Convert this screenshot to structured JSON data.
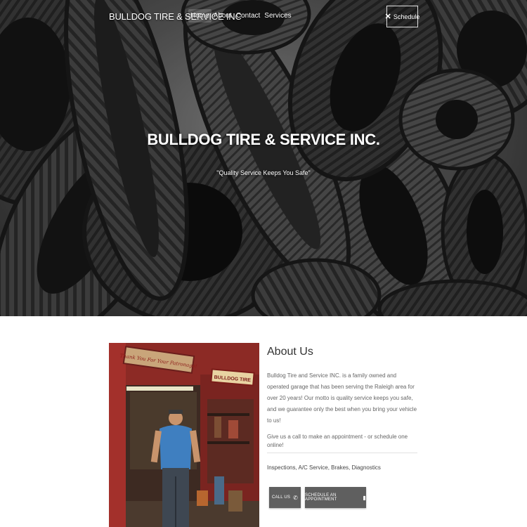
{
  "nav": {
    "brand": "BULLDOG TIRE & SERVICE INC",
    "links": [
      {
        "label": "Home",
        "active": true
      },
      {
        "label": "About",
        "active": false
      },
      {
        "label": "Contact",
        "active": false
      },
      {
        "label": "Services",
        "active": false
      }
    ],
    "schedule_label": "Schedule",
    "schedule_icon": "wrench-icon"
  },
  "hero": {
    "title": "BULLDOG TIRE & SERVICE INC.",
    "tagline": "\"Quality Service Keeps You Safe\""
  },
  "about": {
    "heading": "About Us",
    "paragraph": "Bulldog Tire and Service INC. is a family owned and operated garage that has been serving the Raleigh area for over 20 years! Our motto is quality service keeps you safe, and we guarantee only the best when you bring your vehicle to us!",
    "call_to_action": "Give us a call to make an appointment - or schedule one online!",
    "services": "Inspections, A/C Service, Brakes, Diagnostics",
    "photo_signs": [
      "Thank You For Your Patronage!",
      "BULLDOG TIRE"
    ],
    "call_button": "CALL US",
    "call_icon": "phone-icon",
    "appointment_button": "SCHEDULE AN APPOINTMENT",
    "appointment_icon": "mobile-icon"
  }
}
